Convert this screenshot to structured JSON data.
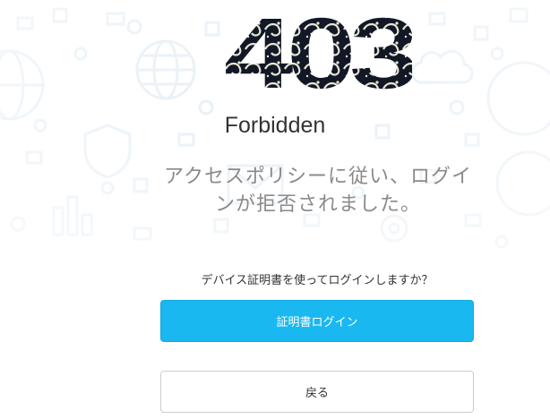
{
  "error": {
    "code": "403",
    "title": "Forbidden",
    "message": "アクセスポリシーに従い、ログインが拒否されました。"
  },
  "prompt": {
    "question": "デバイス証明書を使ってログインしますか？"
  },
  "buttons": {
    "certificate_login": "証明書ログイン",
    "back": "戻る"
  },
  "colors": {
    "primary": "#1ab8f0",
    "title": "#333333",
    "message": "#8a8a8a",
    "border": "#cccccc"
  },
  "icons": [
    "globe-icon",
    "shield-icon",
    "cloud-icon",
    "mail-icon",
    "bar-chart-icon",
    "gear-icon"
  ]
}
